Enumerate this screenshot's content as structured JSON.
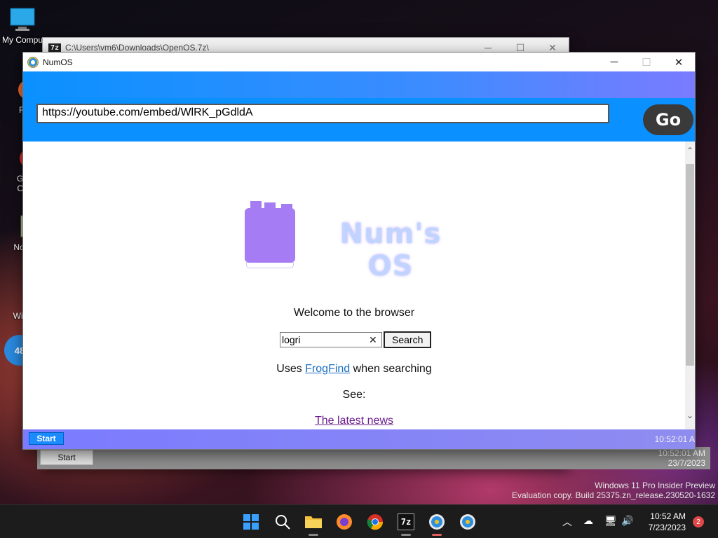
{
  "desktop": {
    "icons": [
      {
        "label": "My Compu"
      },
      {
        "label": "Fi"
      },
      {
        "label": "Go\nCh"
      },
      {
        "label": "Note"
      },
      {
        "label": "Wise"
      },
      {
        "label": "48"
      }
    ]
  },
  "background_window": {
    "title": "C:\\Users\\vm6\\Downloads\\OpenOS.7z\\",
    "badge": "7z",
    "start_label": "Start",
    "clock_time": "10:52:01 AM",
    "clock_date": "23/7/2023"
  },
  "window": {
    "title": "NumOS",
    "controls": {
      "minimize": "─",
      "maximize": "☐",
      "close": "✕"
    }
  },
  "browser": {
    "url": "https://youtube.com/embed/WlRK_pGdldA",
    "go_label": "Go",
    "logo_text": "Num's OS",
    "welcome": "Welcome to the browser",
    "search_value": "logri",
    "search_clear": "✕",
    "search_button": "Search",
    "uses_prefix": "Uses ",
    "uses_link": "FrogFind",
    "uses_suffix": " when searching",
    "see": "See:",
    "news_link": "The latest news"
  },
  "inner_taskbar": {
    "start_label": "Start",
    "clock": "10:52:01 A"
  },
  "watermark": {
    "line1": "Windows 11 Pro Insider Preview",
    "line2": "Evaluation copy. Build 25375.zn_release.230520-1632"
  },
  "taskbar": {
    "apps": [
      "start-icon",
      "search-icon",
      "file-explorer-icon",
      "firefox-icon",
      "chrome-icon",
      "7zip-icon",
      "numos-icon",
      "numos-icon-2"
    ],
    "time": "10:52 AM",
    "date": "7/23/2023",
    "notification_count": "2",
    "colors": {
      "accent": "#0a91ff",
      "taskbar": "#1c1c1c",
      "logo": "#a67cf5"
    }
  }
}
